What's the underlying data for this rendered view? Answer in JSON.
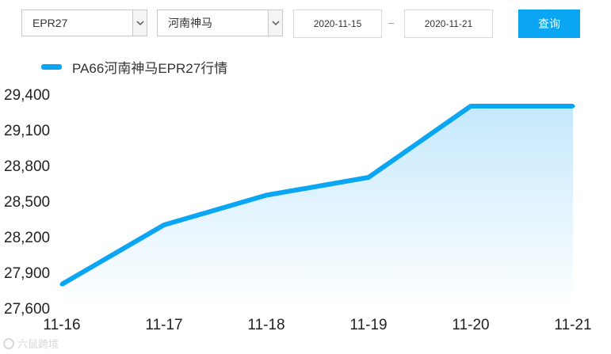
{
  "filters": {
    "grade": "EPR27",
    "manufacturer": "河南神马",
    "start_date": "2020-11-15",
    "separator": "–",
    "end_date": "2020-11-21",
    "query_label": "查询"
  },
  "icons": {
    "dropdown": "chevron-down-icon"
  },
  "legend": {
    "label": "PA66河南神马EPR27行情"
  },
  "colors": {
    "accent": "#0aa6f4",
    "fill_top": "#c5e8fc",
    "fill_bottom": "#ffffff"
  },
  "watermark": "六鼠跨境",
  "chart_data": {
    "type": "area",
    "categories": [
      "11-16",
      "11-17",
      "11-18",
      "11-19",
      "11-20",
      "11-21"
    ],
    "series": [
      {
        "values": [
          27800,
          28300,
          28550,
          28700,
          29300,
          29300
        ]
      }
    ],
    "ylim": [
      27600,
      29400
    ],
    "yticks": [
      27600,
      27900,
      28200,
      28500,
      28800,
      29100,
      29400
    ],
    "ytick_labels": [
      "27,600",
      "27,900",
      "28,200",
      "28,500",
      "28,800",
      "29,100",
      "29,400"
    ],
    "grid": false,
    "legend_position": "top-left"
  }
}
